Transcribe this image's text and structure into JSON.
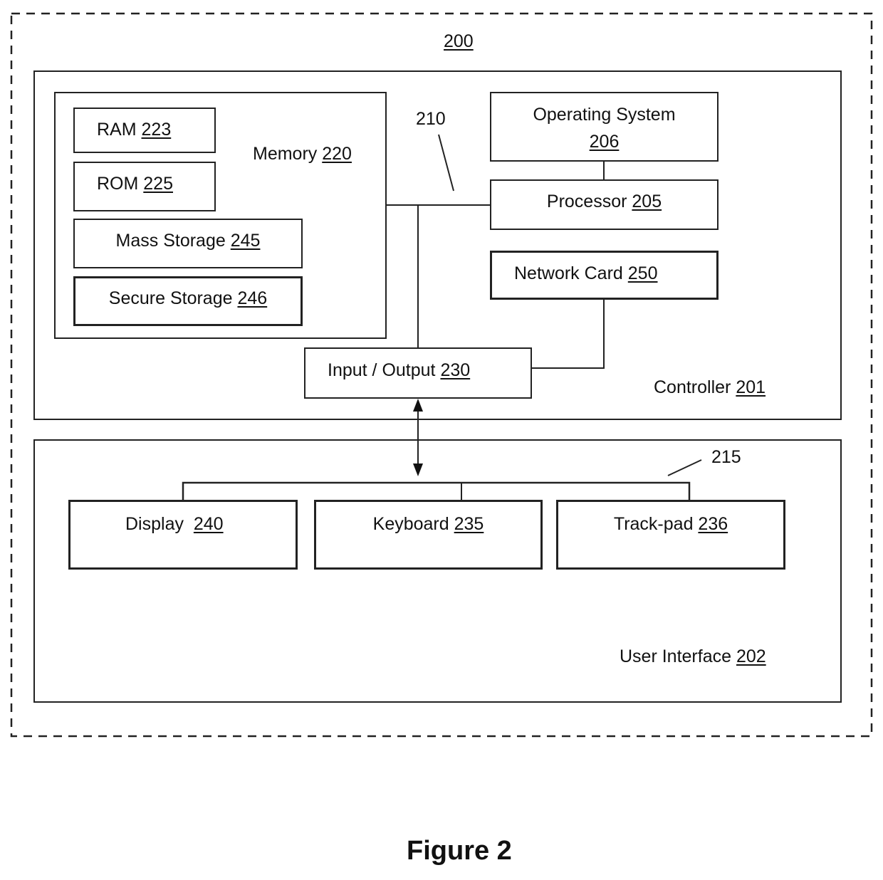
{
  "system": {
    "ref": "200"
  },
  "controller": {
    "name": "Controller",
    "ref": "201"
  },
  "user_interface": {
    "name": "User Interface",
    "ref": "202"
  },
  "memory": {
    "name": "Memory",
    "ref": "220",
    "items": [
      {
        "name": "RAM",
        "ref": "223"
      },
      {
        "name": "ROM",
        "ref": "225"
      },
      {
        "name": "Mass Storage",
        "ref": "245"
      },
      {
        "name": "Secure Storage",
        "ref": "246"
      }
    ]
  },
  "bus": {
    "ref": "210"
  },
  "ui_bus": {
    "ref": "215"
  },
  "operating_system": {
    "name": "Operating System",
    "ref": "206"
  },
  "processor": {
    "name": "Processor",
    "ref": "205"
  },
  "network_card": {
    "name": "Network Card",
    "ref": "250"
  },
  "io": {
    "name": "Input / Output",
    "ref": "230"
  },
  "devices": [
    {
      "name": "Display ",
      "ref": "240"
    },
    {
      "name": "Keyboard",
      "ref": "235"
    },
    {
      "name": "Track-pad",
      "ref": "236"
    }
  ],
  "caption": "Figure 2"
}
